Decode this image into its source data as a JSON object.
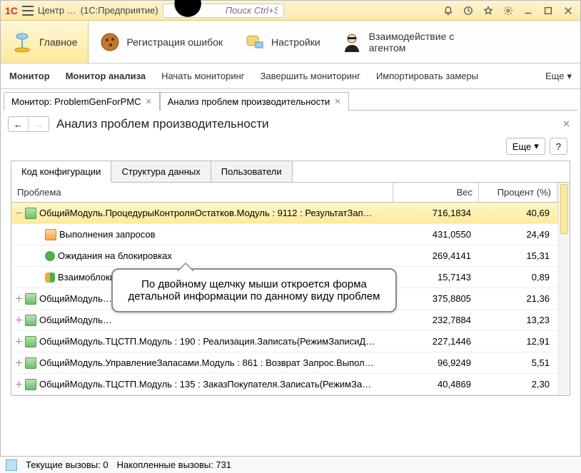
{
  "title": {
    "app": "Центр …",
    "platform": "(1С:Предприятие)"
  },
  "search": {
    "placeholder": "Поиск Ctrl+Shift+F"
  },
  "mainmenu": [
    {
      "label": "Главное"
    },
    {
      "label": "Регистрация ошибок"
    },
    {
      "label": "Настройки"
    },
    {
      "label": "Взаимодействие с агентом"
    }
  ],
  "secmenu": {
    "monitor": "Монитор",
    "analysis": "Монитор анализа",
    "start": "Начать мониторинг",
    "stop": "Завершить мониторинг",
    "import": "Импортировать замеры",
    "more": "Еще"
  },
  "tabs": [
    {
      "label": "Монитор: ProblemGenForPMC"
    },
    {
      "label": "Анализ проблем производительности"
    }
  ],
  "page": {
    "title": "Анализ проблем производительности",
    "more": "Еще",
    "help": "?"
  },
  "viewtabs": {
    "code": "Код конфигурации",
    "struct": "Структура данных",
    "users": "Пользователи"
  },
  "columns": {
    "problem": "Проблема",
    "weight": "Вес",
    "percent": "Процент (%)"
  },
  "rows": [
    {
      "exp": "minus",
      "ind": 0,
      "ico": "mod",
      "name": "ОбщийМодуль.ПроцедурыКонтроляОстатков.Модуль : 9112 : РезультатЗап…",
      "w": "716,1834",
      "p": "40,69",
      "sel": true
    },
    {
      "exp": "none",
      "ind": 1,
      "ico": "q",
      "name": "Выполнения запросов",
      "w": "431,0550",
      "p": "24,49"
    },
    {
      "exp": "none",
      "ind": 1,
      "ico": "lock",
      "name": "Ожидания на блокировках",
      "w": "269,4141",
      "p": "15,31"
    },
    {
      "exp": "none",
      "ind": 1,
      "ico": "pair",
      "name": "Взаимоблокировки",
      "w": "15,7143",
      "p": "0,89"
    },
    {
      "exp": "plus",
      "ind": 0,
      "ico": "mod",
      "name": "ОбщийМодуль…",
      "w": "375,8805",
      "p": "21,36"
    },
    {
      "exp": "plus",
      "ind": 0,
      "ico": "mod",
      "name": "ОбщийМодуль…",
      "w": "232,7884",
      "p": "13,23"
    },
    {
      "exp": "plus",
      "ind": 0,
      "ico": "mod",
      "name": "ОбщийМодуль.ТЦСТП.Модуль : 190 : Реализация.Записать(РежимЗаписиД…",
      "w": "227,1446",
      "p": "12,91"
    },
    {
      "exp": "plus",
      "ind": 0,
      "ico": "mod",
      "name": "ОбщийМодуль.УправлениеЗапасами.Модуль : 861 : Возврат Запрос.Выпол…",
      "w": "96,9249",
      "p": "5,51"
    },
    {
      "exp": "plus",
      "ind": 0,
      "ico": "mod",
      "name": "ОбщийМодуль.ТЦСТП.Модуль : 135 : ЗаказПокупателя.Записать(РежимЗа…",
      "w": "40,4869",
      "p": "2,30"
    }
  ],
  "callout": "По двойному щелчку мыши откроется форма детальной информации по данному виду проблем",
  "status": {
    "current": "Текущие вызовы: 0",
    "accum": "Накопленные вызовы: 731"
  }
}
